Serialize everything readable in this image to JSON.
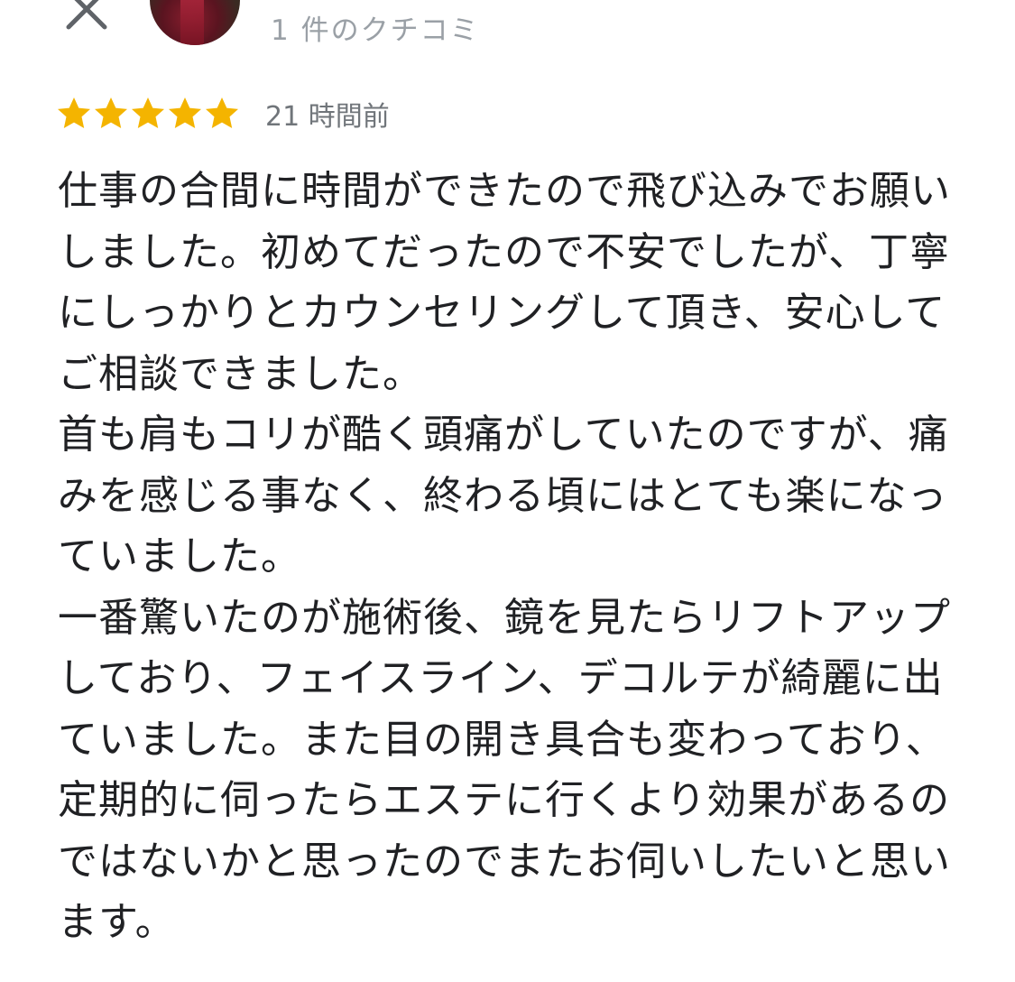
{
  "header": {
    "close_icon": "close-icon",
    "avatar_icon": "avatar",
    "review_count": "1 件のクチコミ"
  },
  "rating": {
    "stars": 5,
    "max_stars": 5,
    "star_color": "#f4b400",
    "time_ago": "21 時間前"
  },
  "review": {
    "lines": [
      "仕事の合間に時間ができたので飛び込みでお願い",
      "しました。初めてだったので不安でしたが、丁寧",
      "にしっかりとカウンセリングして頂き、安心して",
      "ご相談できました。",
      "首も肩もコリが酷く頭痛がしていたのですが、痛",
      "みを感じる事なく、終わる頃にはとても楽になっ",
      "ていました。",
      "一番驚いたのが施術後、鏡を見たらリフトアップ",
      "しており、フェイスライン、デコルテが綺麗に出",
      "ていました。また目の開き具合も変わっており、",
      "定期的に伺ったらエステに行くより効果があるの",
      "ではないかと思ったのでまたお伺いしたいと思い",
      "ます。"
    ]
  }
}
